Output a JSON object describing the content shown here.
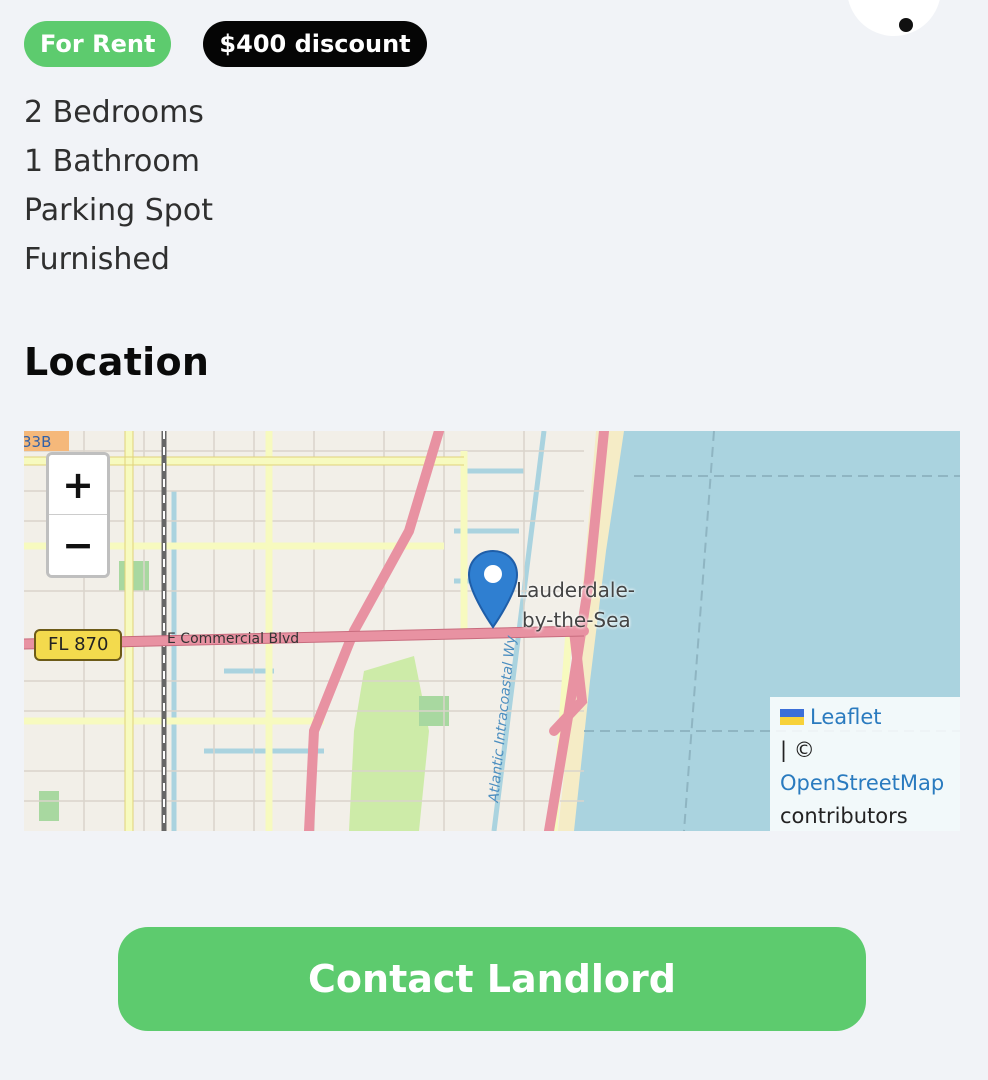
{
  "badges": {
    "rent": "For Rent",
    "discount": "$400 discount"
  },
  "features": [
    "2 Bedrooms",
    "1 Bathroom",
    "Parking Spot",
    "Furnished"
  ],
  "location": {
    "title": "Location"
  },
  "map": {
    "zoom_in": "+",
    "zoom_out": "−",
    "labels": {
      "highway_shield": "FL 870",
      "street": "E Commercial Blvd",
      "place_line1": "Lauderdale-",
      "place_line2": "by-the-Sea",
      "waterway": "Atlantic Intracoastal Wy",
      "corner": "33B"
    },
    "attribution": {
      "leaflet": "Leaflet",
      "separator": "| ©",
      "osm": "OpenStreetMap",
      "contributors": "contributors"
    }
  },
  "contact_button": "Contact Landlord",
  "colors": {
    "accent_green": "#5dcb6e",
    "black_badge": "#050505",
    "sea": "#aad3df",
    "road_primary": "#e892a2",
    "road_secondary": "#f7fabf",
    "marker": "#2f7fd1"
  }
}
